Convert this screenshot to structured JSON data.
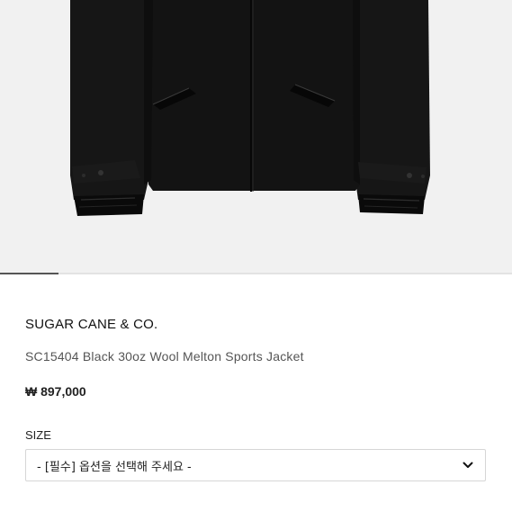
{
  "product": {
    "brand": "SUGAR CANE & CO.",
    "name": "SC15404 Black 30oz Wool Melton Sports Jacket",
    "price": "₩ 897,000"
  },
  "gallery": {
    "image_description": "Black wool jacket with leather trim",
    "progress": 0.115
  },
  "options": {
    "size_label": "SIZE",
    "size_selected": "- [필수] 옵션을 선택해 주세요 -"
  },
  "colors": {
    "background": "#ffffff",
    "image_bg": "#f1f1f1",
    "jacket": "#151515",
    "leather": "#0b0b0b"
  }
}
